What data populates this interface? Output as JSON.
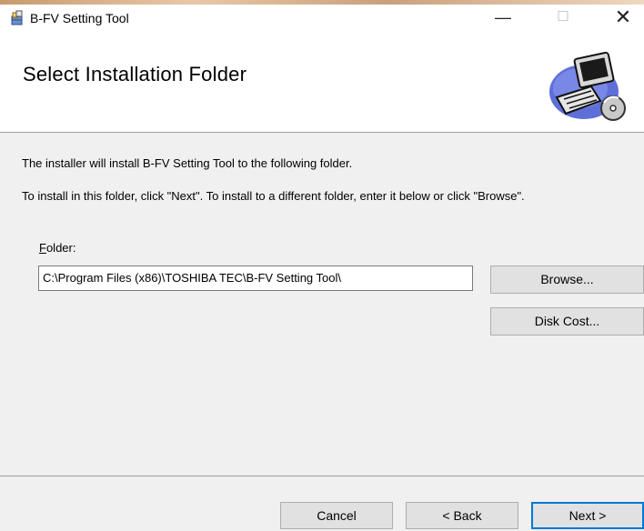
{
  "window": {
    "title": "B-FV Setting Tool",
    "min_glyph": "—",
    "max_glyph": "☐",
    "close_glyph": "✕",
    "icon": "installer-box-icon"
  },
  "banner": {
    "title": "Select Installation Folder",
    "image": "computer-setup-icon"
  },
  "content": {
    "line1": "The installer will install B-FV Setting Tool to the following folder.",
    "line2": "To install in this folder, click \"Next\". To install to a different folder, enter it below or click \"Browse\".",
    "folder_label_mnemonic": "F",
    "folder_label_rest": "older:",
    "folder_value": "C:\\Program Files (x86)\\TOSHIBA TEC\\B-FV Setting Tool\\",
    "browse_label": "Browse...",
    "disk_cost_label": "Disk Cost..."
  },
  "footer": {
    "cancel_label": "Cancel",
    "back_label": "< Back",
    "next_label": "Next >"
  },
  "colors": {
    "panel": "#f0f0f0",
    "button": "#e1e1e1",
    "default_button_border": "#0078d7"
  }
}
